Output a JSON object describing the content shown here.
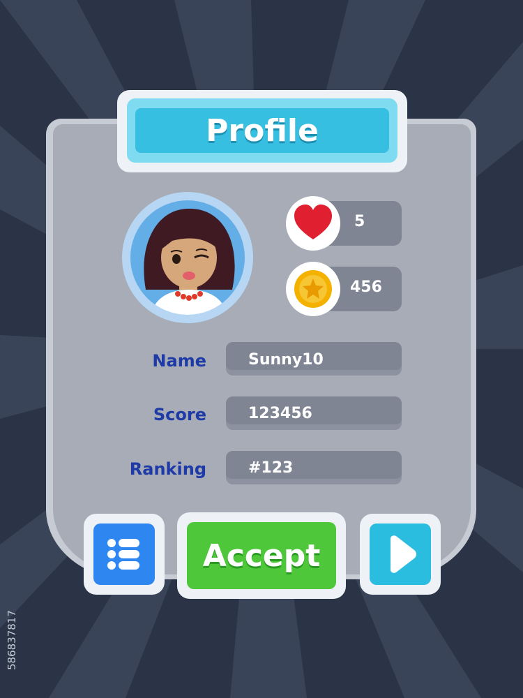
{
  "screen": {
    "title": "Profile",
    "colors": {
      "background": "#2b3446",
      "panel": "#a7acb7",
      "title_bar": "#36bfe0",
      "label_text": "#1e3aa6",
      "accept_button": "#4ec83a",
      "menu_button": "#2e86f0",
      "play_button": "#2bbde0",
      "heart": "#e02030",
      "coin": "#f5b100"
    }
  },
  "player": {
    "avatar_icon": "girl-avatar-icon",
    "lives": "5",
    "coins": "456"
  },
  "fields": {
    "name_label": "Name",
    "name_value": "Sunny10",
    "score_label": "Score",
    "score_value": "123456",
    "ranking_label": "Ranking",
    "ranking_value": "#123"
  },
  "buttons": {
    "menu_icon": "list-menu-icon",
    "accept_label": "Accept",
    "play_icon": "play-icon"
  },
  "watermark": {
    "stock_id": "586837817"
  }
}
